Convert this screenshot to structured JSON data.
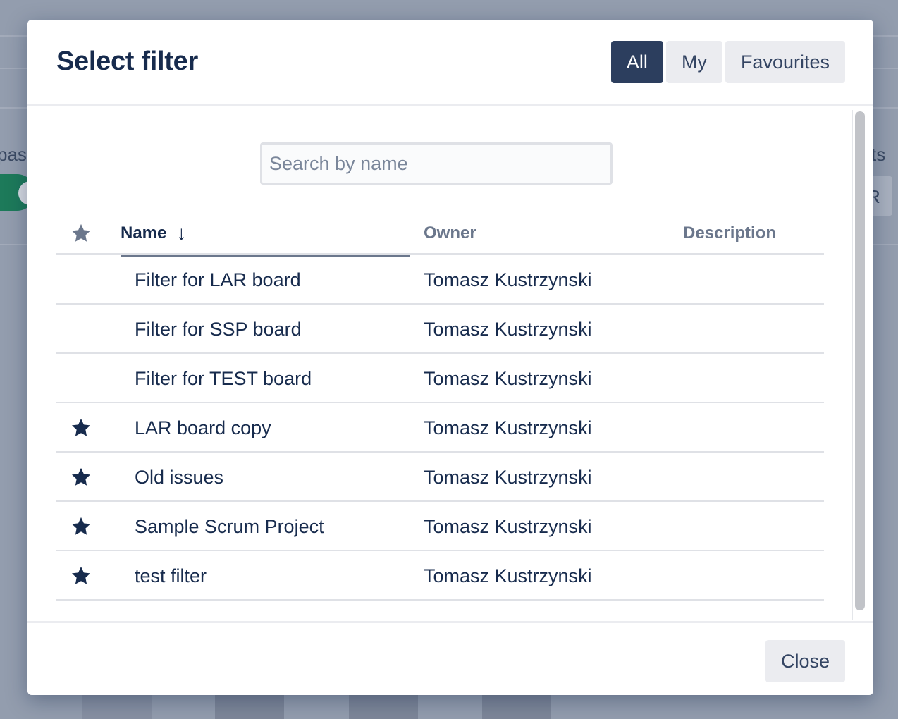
{
  "background": {
    "left_text": "pas",
    "right_text": "ts",
    "chip_text": "R"
  },
  "modal": {
    "title": "Select filter",
    "tabs": [
      {
        "label": "All",
        "active": true
      },
      {
        "label": "My",
        "active": false
      },
      {
        "label": "Favourites",
        "active": false
      }
    ],
    "search": {
      "placeholder": "Search by name",
      "value": ""
    },
    "table": {
      "columns": {
        "favourite": "favourite-star",
        "name": "Name",
        "owner": "Owner",
        "description": "Description"
      },
      "sort": {
        "column": "Name",
        "direction": "descending-arrow"
      },
      "rows": [
        {
          "favourite": false,
          "name": "Filter for LAR board",
          "owner": "Tomasz Kustrzynski",
          "description": ""
        },
        {
          "favourite": false,
          "name": "Filter for SSP board",
          "owner": "Tomasz Kustrzynski",
          "description": ""
        },
        {
          "favourite": false,
          "name": "Filter for TEST board",
          "owner": "Tomasz Kustrzynski",
          "description": ""
        },
        {
          "favourite": true,
          "name": "LAR board copy",
          "owner": "Tomasz Kustrzynski",
          "description": ""
        },
        {
          "favourite": true,
          "name": "Old issues",
          "owner": "Tomasz Kustrzynski",
          "description": ""
        },
        {
          "favourite": true,
          "name": "Sample Scrum Project",
          "owner": "Tomasz Kustrzynski",
          "description": ""
        },
        {
          "favourite": true,
          "name": "test filter",
          "owner": "Tomasz Kustrzynski",
          "description": ""
        }
      ]
    },
    "footer": {
      "close_label": "Close"
    }
  },
  "colors": {
    "primary_text": "#172b4d",
    "active_tab": "#2c3e5e",
    "button_bg": "#ebecf0",
    "header_star": "#6b778c",
    "overlay": "#939dae"
  }
}
